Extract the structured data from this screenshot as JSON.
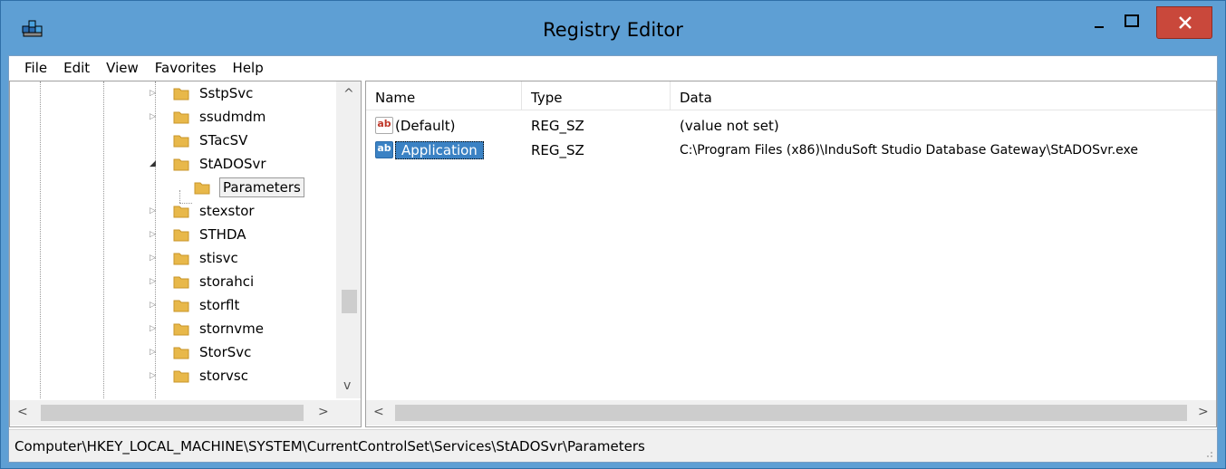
{
  "window": {
    "title": "Registry Editor",
    "app_icon": "regedit-icon",
    "controls": [
      "minimize-icon",
      "maximize-icon",
      "close-icon"
    ]
  },
  "menu": {
    "items": [
      {
        "label": "File"
      },
      {
        "label": "Edit"
      },
      {
        "label": "View"
      },
      {
        "label": "Favorites"
      },
      {
        "label": "Help"
      }
    ]
  },
  "tree": {
    "items": [
      {
        "label": "SstpSvc",
        "expander": "collapsed",
        "level": 0
      },
      {
        "label": "ssudmdm",
        "expander": "collapsed",
        "level": 0
      },
      {
        "label": "STacSV",
        "expander": "none",
        "level": 0
      },
      {
        "label": "StADOSvr",
        "expander": "expanded",
        "level": 0
      },
      {
        "label": "Parameters",
        "expander": "none",
        "level": 1,
        "selected": true
      },
      {
        "label": "stexstor",
        "expander": "collapsed",
        "level": 0
      },
      {
        "label": "STHDA",
        "expander": "collapsed",
        "level": 0
      },
      {
        "label": "stisvc",
        "expander": "collapsed",
        "level": 0
      },
      {
        "label": "storahci",
        "expander": "collapsed",
        "level": 0
      },
      {
        "label": "storflt",
        "expander": "collapsed",
        "level": 0
      },
      {
        "label": "stornvme",
        "expander": "collapsed",
        "level": 0
      },
      {
        "label": "StorSvc",
        "expander": "collapsed",
        "level": 0
      },
      {
        "label": "storvsc",
        "expander": "collapsed",
        "level": 0
      }
    ]
  },
  "values_list": {
    "columns": [
      "Name",
      "Type",
      "Data"
    ],
    "rows": [
      {
        "name": "(Default)",
        "type": "REG_SZ",
        "data": "(value not set)",
        "selected": false
      },
      {
        "name": "Application",
        "type": "REG_SZ",
        "data": "C:\\Program Files (x86)\\InduSoft Studio Database Gateway\\StADOSvr.exe",
        "selected": true
      }
    ]
  },
  "status_bar": {
    "path": "Computer\\HKEY_LOCAL_MACHINE\\SYSTEM\\CurrentControlSet\\Services\\StADOSvr\\Parameters"
  },
  "colors": {
    "titlebar": "#5e9fd4",
    "close_button": "#c9483b",
    "selection": "#3b82c4",
    "folder": "#e8b84a"
  }
}
